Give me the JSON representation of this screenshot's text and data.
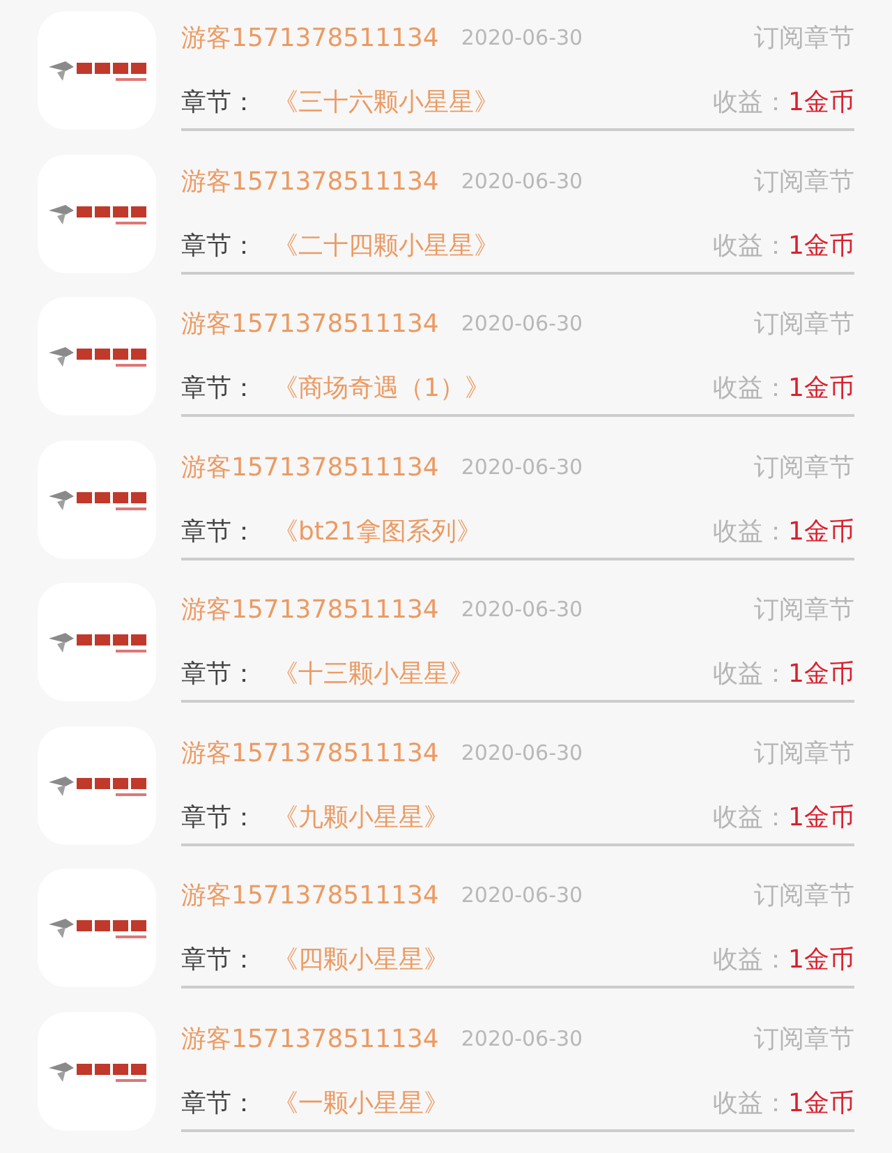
{
  "records": [
    {
      "user": "游客1571378511134",
      "date": "2020-06-30",
      "type": "订阅章节",
      "chapter_label": "章节：",
      "chapter": "《三十六颗小星星》",
      "income_label": "收益：",
      "income": "1金币"
    },
    {
      "user": "游客1571378511134",
      "date": "2020-06-30",
      "type": "订阅章节",
      "chapter_label": "章节：",
      "chapter": "《二十四颗小星星》",
      "income_label": "收益：",
      "income": "1金币"
    },
    {
      "user": "游客1571378511134",
      "date": "2020-06-30",
      "type": "订阅章节",
      "chapter_label": "章节：",
      "chapter": "《商场奇遇（1）》",
      "income_label": "收益：",
      "income": "1金币"
    },
    {
      "user": "游客1571378511134",
      "date": "2020-06-30",
      "type": "订阅章节",
      "chapter_label": "章节：",
      "chapter": "《bt21拿图系列》",
      "income_label": "收益：",
      "income": "1金币"
    },
    {
      "user": "游客1571378511134",
      "date": "2020-06-30",
      "type": "订阅章节",
      "chapter_label": "章节：",
      "chapter": "《十三颗小星星》",
      "income_label": "收益：",
      "income": "1金币"
    },
    {
      "user": "游客1571378511134",
      "date": "2020-06-30",
      "type": "订阅章节",
      "chapter_label": "章节：",
      "chapter": "《九颗小星星》",
      "income_label": "收益：",
      "income": "1金币"
    },
    {
      "user": "游客1571378511134",
      "date": "2020-06-30",
      "type": "订阅章节",
      "chapter_label": "章节：",
      "chapter": "《四颗小星星》",
      "income_label": "收益：",
      "income": "1金币"
    },
    {
      "user": "游客1571378511134",
      "date": "2020-06-30",
      "type": "订阅章节",
      "chapter_label": "章节：",
      "chapter": "《一颗小星星》",
      "income_label": "收益：",
      "income": "1金币"
    }
  ]
}
